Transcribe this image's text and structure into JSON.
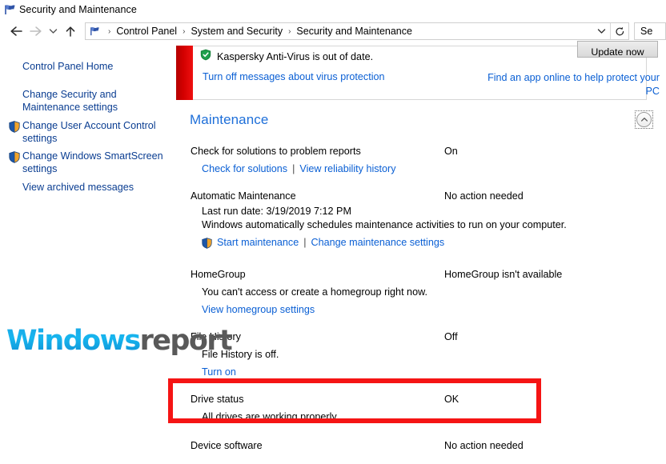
{
  "window": {
    "title": "Security and Maintenance",
    "title_icon": "flag-icon"
  },
  "navbar": {
    "back_icon": "arrow-left-icon",
    "forward_icon": "arrow-right-icon",
    "recent_icon": "chevron-down-icon",
    "up_icon": "arrow-up-icon",
    "breadcrumb_icon": "flag-icon",
    "breadcrumbs": [
      {
        "label": "Control Panel"
      },
      {
        "label": "System and Security"
      },
      {
        "label": "Security and Maintenance"
      }
    ],
    "separator": "›",
    "dropdown_icon": "chevron-down-icon",
    "refresh_icon": "refresh-icon",
    "search_value": "Se"
  },
  "sidebar": {
    "items": [
      {
        "label": "Control Panel Home",
        "icon": null
      },
      {
        "label": "Change Security and Maintenance settings",
        "icon": null
      },
      {
        "label": "Change User Account Control settings",
        "icon": "uac-shield-icon"
      },
      {
        "label": "Change Windows SmartScreen settings",
        "icon": "uac-shield-icon"
      },
      {
        "label": "View archived messages",
        "icon": null
      }
    ]
  },
  "alert": {
    "icon": "green-shield-check-icon",
    "message": "Kaspersky Anti-Virus is out of date.",
    "left_link": "Turn off messages about virus protection",
    "right_link": "Find an app online to help protect your PC",
    "button_label": "Update now",
    "stripe_color": "#d40000"
  },
  "maintenance": {
    "heading": "Maintenance",
    "collapse_icon": "chevron-up-circle-icon",
    "rows": [
      {
        "title": "Check for solutions to problem reports",
        "status": "On",
        "sub": null,
        "links": [
          {
            "label": "Check for solutions",
            "icon": null
          },
          {
            "label": "View reliability history",
            "icon": null
          }
        ]
      },
      {
        "title": "Automatic Maintenance",
        "status": "No action needed",
        "sub": "Last run date: 3/19/2019 7:12 PM",
        "sub2": "Windows automatically schedules maintenance activities to run on your computer.",
        "links": [
          {
            "label": "Start maintenance",
            "icon": "uac-shield-icon"
          },
          {
            "label": "Change maintenance settings",
            "icon": null
          }
        ]
      },
      {
        "title": "HomeGroup",
        "status": "HomeGroup isn't available",
        "sub": "You can't access or create a homegroup right now.",
        "links": [
          {
            "label": "View homegroup settings",
            "icon": null
          }
        ]
      },
      {
        "title": "File History",
        "status": "Off",
        "sub": "File History is off.",
        "links": [
          {
            "label": "Turn on",
            "icon": null
          }
        ]
      },
      {
        "title": "Drive status",
        "status": "OK",
        "sub": "All drives are working properly.",
        "links": []
      },
      {
        "title": "Device software",
        "status": "No action needed",
        "sub": null,
        "links": []
      }
    ]
  },
  "annotation": {
    "highlight_color": "#f51414",
    "target": "Drive status"
  },
  "watermark": {
    "part1": "Windows",
    "part2": "report",
    "color1": "#1aa9e8",
    "color2": "#595959"
  }
}
